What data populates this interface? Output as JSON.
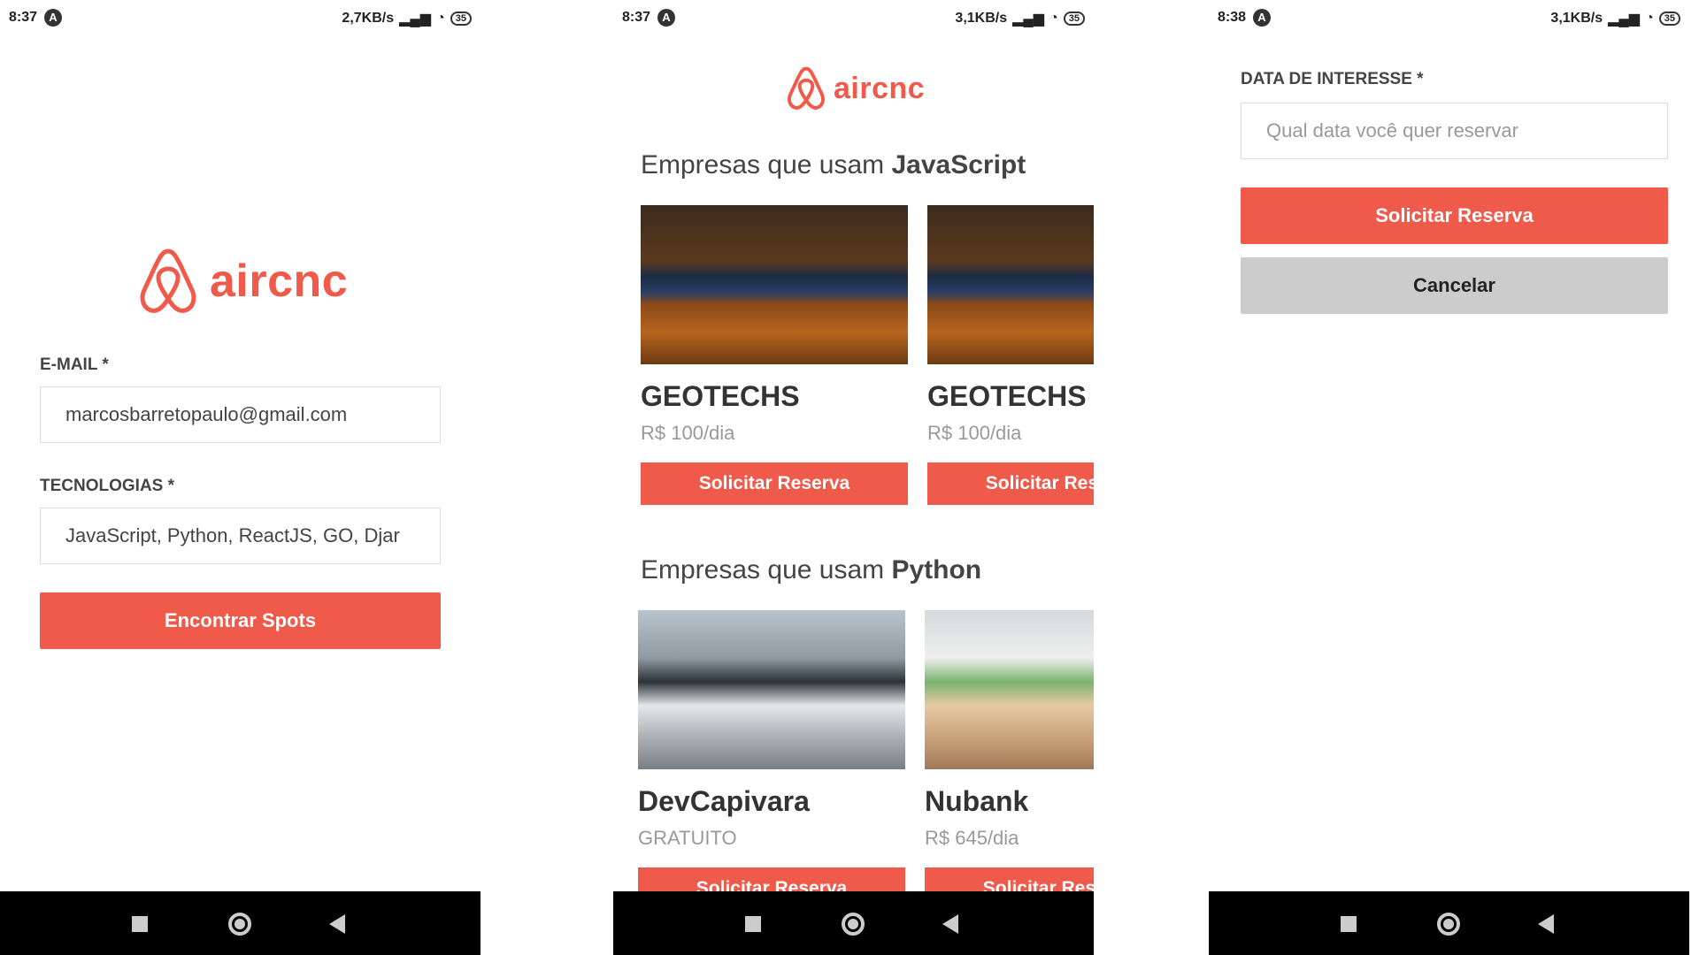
{
  "screens": {
    "login": {
      "status": {
        "time": "8:37",
        "speed": "2,7KB/s",
        "battery": "35"
      },
      "logo_text": "aircnc",
      "email_label": "E-MAIL *",
      "email_value": "marcosbarretopaulo@gmail.com",
      "tech_label": "TECNOLOGIAS *",
      "tech_value": "JavaScript, Python, ReactJS, GO, Djar",
      "submit_label": "Encontrar Spots"
    },
    "list": {
      "status": {
        "time": "8:37",
        "speed": "3,1KB/s",
        "battery": "35"
      },
      "logo_text": "aircnc",
      "sections": [
        {
          "title_prefix": "Empresas que usam ",
          "tech": "JavaScript",
          "cards": [
            {
              "name": "GEOTECHS",
              "price": "R$ 100/dia",
              "button": "Solicitar Reserva"
            },
            {
              "name": "GEOTECHS",
              "price": "R$ 100/dia",
              "button": "Solicitar Reserva"
            }
          ]
        },
        {
          "title_prefix": "Empresas que usam ",
          "tech": "Python",
          "cards": [
            {
              "name": "DevCapivara",
              "price": "GRATUITO",
              "button": "Solicitar Reserva"
            },
            {
              "name": "Nubank",
              "price": "R$ 645/dia",
              "button": "Solicitar Reserva"
            }
          ]
        }
      ]
    },
    "book": {
      "status": {
        "time": "8:38",
        "speed": "3,1KB/s",
        "battery": "35"
      },
      "date_label": "DATA DE INTERESSE *",
      "date_placeholder": "Qual data você quer reservar",
      "submit_label": "Solicitar Reserva",
      "cancel_label": "Cancelar"
    }
  },
  "colors": {
    "accent": "#f05a4b",
    "cancel": "#cccccc",
    "navbar": "#000000"
  },
  "icons": [
    "a-icon",
    "signal-icon",
    "wifi-icon",
    "battery-icon",
    "airbnb-logo-icon",
    "nav-square-icon",
    "nav-home-icon",
    "nav-back-icon"
  ]
}
